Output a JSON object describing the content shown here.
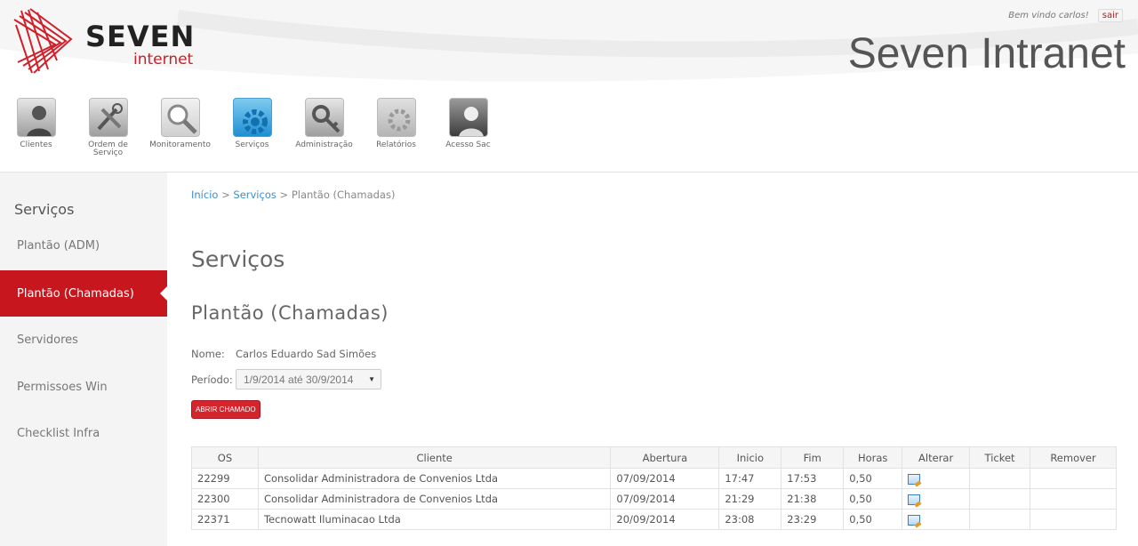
{
  "header": {
    "logo_main": "SEVEN",
    "logo_sub": "internet",
    "welcome": "Bem vindo carlos!",
    "logout_label": "sair",
    "site_title": "Seven Intranet"
  },
  "menu": [
    {
      "label": "Clientes",
      "icon": "clients-icon"
    },
    {
      "label": "Ordem de Serviço",
      "icon": "work-order-icon"
    },
    {
      "label": "Monitoramento",
      "icon": "monitoring-icon"
    },
    {
      "label": "Serviços",
      "icon": "services-gear-icon"
    },
    {
      "label": "Administração",
      "icon": "admin-key-icon"
    },
    {
      "label": "Relatórios",
      "icon": "reports-icon"
    },
    {
      "label": "Acesso Sac",
      "icon": "support-access-icon"
    }
  ],
  "sidebar": {
    "title": "Serviços",
    "items": [
      {
        "label": "Plantão (ADM)"
      },
      {
        "label": "Plantão (Chamadas)"
      },
      {
        "label": "Servidores"
      },
      {
        "label": "Permissoes Win"
      },
      {
        "label": "Checklist Infra"
      }
    ]
  },
  "breadcrumb": {
    "home": "Início",
    "section": "Serviços",
    "current": "Plantão (Chamadas)",
    "separator": ">"
  },
  "page": {
    "title": "Serviços",
    "subtitle": "Plantão (Chamadas)",
    "name_label": "Nome:",
    "name_value": "Carlos Eduardo Sad Simões",
    "period_label": "Período:",
    "period_value": "1/9/2014 até 30/9/2014",
    "open_button": "ABRIR CHAMADO"
  },
  "table": {
    "headers": [
      "OS",
      "Cliente",
      "Abertura",
      "Inicio",
      "Fim",
      "Horas",
      "Alterar",
      "Ticket",
      "Remover"
    ],
    "rows": [
      {
        "os": "22299",
        "cliente": "Consolidar Administradora de Convenios Ltda",
        "abertura": "07/09/2014",
        "inicio": "17:47",
        "fim": "17:53",
        "horas": "0,50"
      },
      {
        "os": "22300",
        "cliente": "Consolidar Administradora de Convenios Ltda",
        "abertura": "07/09/2014",
        "inicio": "21:29",
        "fim": "21:38",
        "horas": "0,50"
      },
      {
        "os": "22371",
        "cliente": "Tecnowatt Iluminacao Ltda",
        "abertura": "20/09/2014",
        "inicio": "23:08",
        "fim": "23:29",
        "horas": "0,50"
      }
    ]
  },
  "colors": {
    "brand_red": "#c8161e",
    "link_blue": "#3a8fd0",
    "sidebar_bg": "#f4f4f4"
  }
}
